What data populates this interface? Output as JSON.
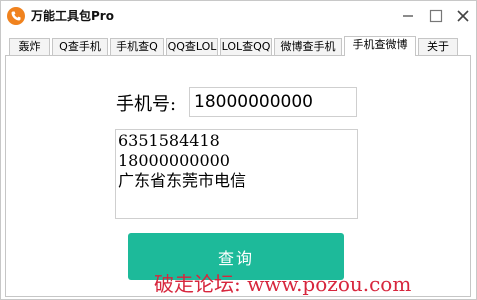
{
  "window": {
    "title": "万能工具包Pro",
    "controls": [
      "minimize-icon",
      "maximize-icon",
      "close-icon"
    ]
  },
  "tabs": [
    {
      "label": "轰炸",
      "active": false
    },
    {
      "label": "Q查手机",
      "active": false
    },
    {
      "label": "手机查Q",
      "active": false
    },
    {
      "label": "QQ查LOL",
      "active": false
    },
    {
      "label": "LOL查QQ",
      "active": false
    },
    {
      "label": "微博查手机",
      "active": false
    },
    {
      "label": "手机查微博",
      "active": true
    },
    {
      "label": "关于",
      "active": false
    }
  ],
  "form": {
    "phone_label": "手机号:",
    "phone_value": "18000000000",
    "result_lines": [
      "6351584418",
      "18000000000",
      "广东省东莞市电信"
    ],
    "query_button": "查询"
  },
  "watermark": "破走论坛: www.pozou.com",
  "colors": {
    "accent": "#1dba9a",
    "app_icon": "#f0821e",
    "watermark": "#d7263d"
  }
}
